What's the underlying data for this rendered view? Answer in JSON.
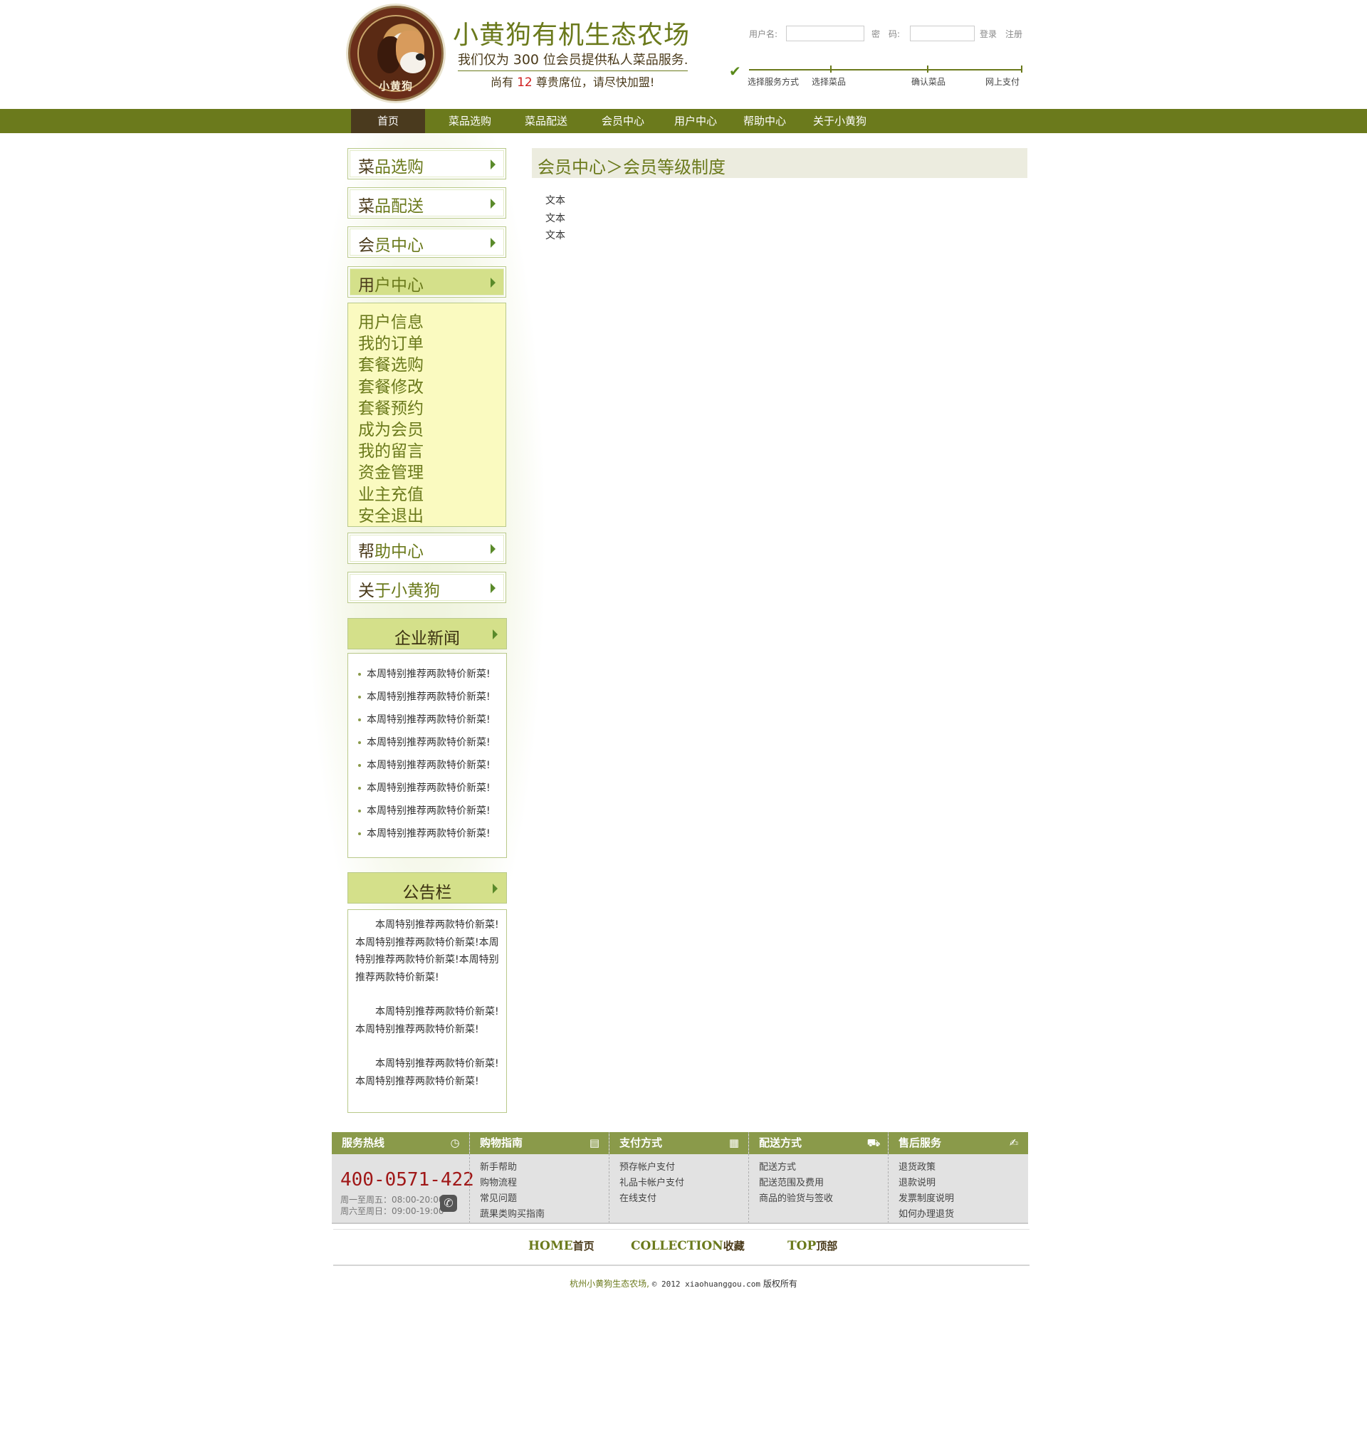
{
  "header": {
    "logo_text": "小黄狗",
    "site_title": "小黄狗有机生态农场",
    "slogan_prefix": "我们仅为 ",
    "slogan_num": "300",
    "slogan_suffix": " 位会员提供私人菜品服务.",
    "seats_prefix": "尚有 ",
    "seats_num": "12",
    "seats_suffix": " 尊贵席位，请尽快加盟!",
    "username_label": "用户名:",
    "password_label": "密　码:",
    "username_value": "",
    "password_value": "",
    "login_label": "登录",
    "register_label": "注册",
    "steps": [
      "选择服务方式",
      "选择菜品",
      "确认菜品",
      "网上支付"
    ]
  },
  "nav": {
    "items": [
      "首页",
      "菜品选购",
      "菜品配送",
      "会员中心",
      "用户中心",
      "帮助中心",
      "关于小黄狗"
    ],
    "active_index": 0
  },
  "sidebar": {
    "menu": [
      {
        "first": "菜",
        "rest": "品选购"
      },
      {
        "first": "菜",
        "rest": "品配送"
      },
      {
        "first": "会",
        "rest": "员中心"
      },
      {
        "first": "用",
        "rest": "户中心"
      },
      {
        "first": "帮",
        "rest": "助中心"
      },
      {
        "first": "关",
        "rest": "于小黄狗"
      }
    ],
    "active_menu_index": 3,
    "sub_items": [
      "用户信息",
      "我的订单",
      "套餐选购",
      "套餐修改",
      "套餐预约",
      "成为会员",
      "我的留言",
      "资金管理",
      "业主充值",
      "安全退出"
    ],
    "news_title": "企业新闻",
    "news_items": [
      "本周特别推荐两款特价新菜!",
      "本周特别推荐两款特价新菜!",
      "本周特别推荐两款特价新菜!",
      "本周特别推荐两款特价新菜!",
      "本周特别推荐两款特价新菜!",
      "本周特别推荐两款特价新菜!",
      "本周特别推荐两款特价新菜!",
      "本周特别推荐两款特价新菜!"
    ],
    "notice_title": "公告栏",
    "notice_paragraphs": [
      "本周特别推荐两款特价新菜!本周特别推荐两款特价新菜!本周特别推荐两款特价新菜!本周特别推荐两款特价新菜!",
      "本周特别推荐两款特价新菜!本周特别推荐两款特价新菜!",
      "本周特别推荐两款特价新菜!本周特别推荐两款特价新菜!"
    ]
  },
  "main": {
    "breadcrumb": "会员中心＞会员等级制度",
    "lines": [
      "文本",
      "文本",
      "文本"
    ]
  },
  "footer": {
    "columns": [
      {
        "title": "服务热线",
        "icon": "clock-icon",
        "glyph": "◷"
      },
      {
        "title": "购物指南",
        "icon": "book-icon",
        "glyph": "▤",
        "links": [
          "新手帮助",
          "购物流程",
          "常见问题",
          "蔬果类购买指南"
        ]
      },
      {
        "title": "支付方式",
        "icon": "card-icon",
        "glyph": "▦",
        "links": [
          "预存帐户支付",
          "礼品卡帐户支付",
          "在线支付"
        ]
      },
      {
        "title": "配送方式",
        "icon": "truck-icon",
        "glyph": "⛟",
        "links": [
          "配送方式",
          "配送范围及费用",
          "商品的验货与签收"
        ]
      },
      {
        "title": "售后服务",
        "icon": "service-icon",
        "glyph": "✍",
        "links": [
          "退货政策",
          "退款说明",
          "发票制度说明",
          "如何办理退货"
        ]
      }
    ],
    "hotline": "400-0571-422",
    "hours": [
      "周一至周五：08:00-20:00",
      "周六至周日：09:00-19:00"
    ],
    "bottom_links": [
      {
        "en": "HOME",
        "cn": "首页"
      },
      {
        "en": "COLLECTION",
        "cn": "收藏"
      },
      {
        "en": "TOP",
        "cn": "顶部"
      }
    ],
    "copyright_brand": "杭州小黄狗生态农场,",
    "copyright_mid": "© 2012 xiaohuanggou.com",
    "copyright_tail": "版权所有"
  },
  "colors": {
    "brand_green": "#6b7a1c",
    "nav_active": "#4a3a1e",
    "sidebar_active": "#d4e08a",
    "submenu_bg": "#fafac0",
    "hotline_red": "#a01818"
  }
}
